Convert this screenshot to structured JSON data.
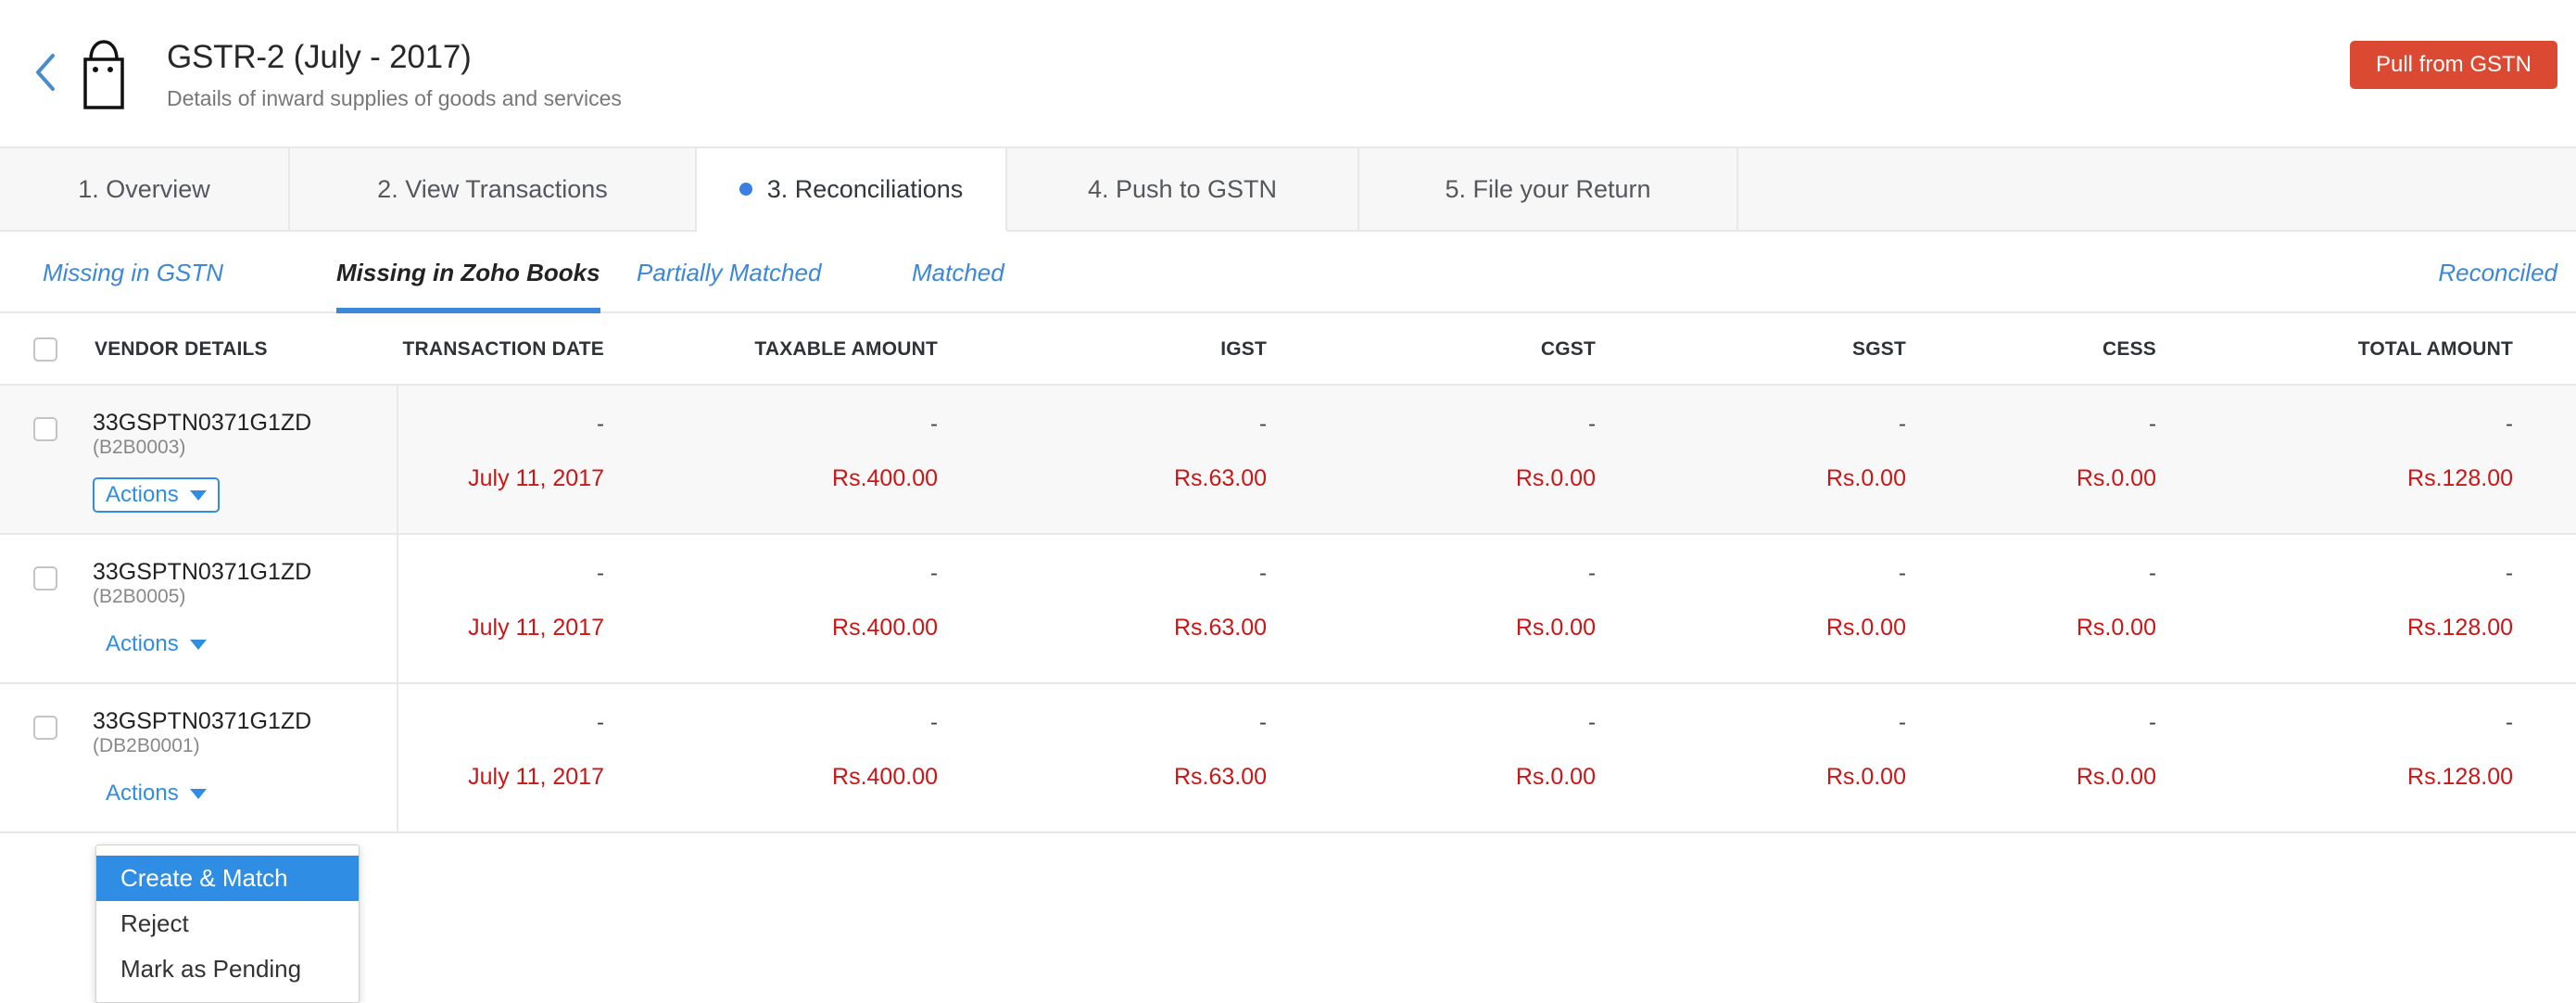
{
  "header": {
    "back_icon": "chevron-left-icon",
    "bag_icon": "shopping-bag-icon",
    "title": "GSTR-2 (July - 2017)",
    "subtitle": "Details of inward supplies of goods and services",
    "pull_button": "Pull from GSTN",
    "accent_red": "#dc4932",
    "accent_blue": "#3d87d8"
  },
  "step_tabs": [
    {
      "label": "1. Overview",
      "active": false
    },
    {
      "label": "2. View Transactions",
      "active": false
    },
    {
      "label": "3. Reconciliations",
      "active": true
    },
    {
      "label": "4. Push to GSTN",
      "active": false
    },
    {
      "label": "5. File your Return",
      "active": false
    }
  ],
  "subnav": {
    "items": [
      {
        "label": "Missing in GSTN",
        "active": false
      },
      {
        "label": "Missing in Zoho Books",
        "active": true
      },
      {
        "label": "Partially Matched",
        "active": false
      },
      {
        "label": "Matched",
        "active": false
      }
    ],
    "right_link": "Reconciled"
  },
  "table": {
    "columns": [
      "VENDOR DETAILS",
      "TRANSACTION DATE",
      "TAXABLE AMOUNT",
      "IGST",
      "CGST",
      "SGST",
      "CESS",
      "TOTAL AMOUNT"
    ],
    "rows": [
      {
        "vendor_name": "33GSPTN0371G1ZD",
        "vendor_code": "(B2B0003)",
        "actions_label": "Actions",
        "date_dash": "-",
        "date": "July 11, 2017",
        "taxable_dash": "-",
        "taxable": "Rs.400.00",
        "igst_dash": "-",
        "igst": "Rs.63.00",
        "cgst_dash": "-",
        "cgst": "Rs.0.00",
        "sgst_dash": "-",
        "sgst": "Rs.0.00",
        "cess_dash": "-",
        "cess": "Rs.0.00",
        "total_dash": "-",
        "total": "Rs.128.00"
      },
      {
        "vendor_name": "33GSPTN0371G1ZD",
        "vendor_code": "(B2B0005)",
        "actions_label": "Actions",
        "date_dash": "-",
        "date": "July 11, 2017",
        "taxable_dash": "-",
        "taxable": "Rs.400.00",
        "igst_dash": "-",
        "igst": "Rs.63.00",
        "cgst_dash": "-",
        "cgst": "Rs.0.00",
        "sgst_dash": "-",
        "sgst": "Rs.0.00",
        "cess_dash": "-",
        "cess": "Rs.0.00",
        "total_dash": "-",
        "total": "Rs.128.00"
      },
      {
        "vendor_name": "33GSPTN0371G1ZD",
        "vendor_code": "(DB2B0001)",
        "actions_label": "Actions",
        "date_dash": "-",
        "date": "July 11, 2017",
        "taxable_dash": "-",
        "taxable": "Rs.400.00",
        "igst_dash": "-",
        "igst": "Rs.63.00",
        "cgst_dash": "-",
        "cgst": "Rs.0.00",
        "sgst_dash": "-",
        "sgst": "Rs.0.00",
        "cess_dash": "-",
        "cess": "Rs.0.00",
        "total_dash": "-",
        "total": "Rs.128.00"
      }
    ]
  },
  "dropdown": {
    "items": [
      {
        "label": "Create & Match",
        "selected": true
      },
      {
        "label": "Reject",
        "selected": false
      },
      {
        "label": "Mark as Pending",
        "selected": false
      }
    ],
    "highlight_color": "#2f8de4"
  }
}
